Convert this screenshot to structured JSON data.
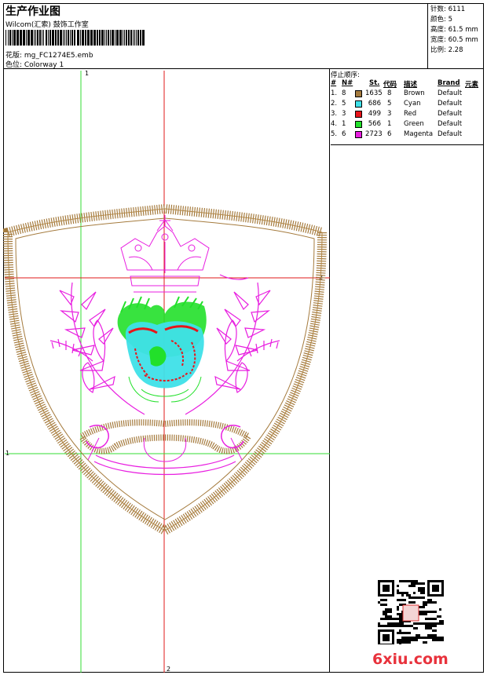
{
  "header": {
    "title": "生产作业图",
    "company": "Wilcom(汇索) 鼓饰工作室",
    "file_label": "花版: mg_FC1274E5.emb",
    "color_label": "色位: Colorway 1"
  },
  "stats": {
    "stitches": "针数: 6111",
    "colors": "颜色: 5",
    "height": "高度: 61.5 mm",
    "width": "宽度: 60.5 mm",
    "scale": "比例: 2.28"
  },
  "guides": {
    "v1": "1",
    "v2": "2",
    "h1": "1",
    "h2": "2"
  },
  "legend": {
    "title": "停止顺序:",
    "headers": [
      "#",
      "N#",
      "St.",
      "代码",
      "描述",
      "Brand",
      "元素"
    ],
    "rows": [
      {
        "idx": "1.",
        "n": "8",
        "st": "1635",
        "code": "8",
        "desc": "Brown",
        "brand": "Default",
        "color": "#a57b3e"
      },
      {
        "idx": "2.",
        "n": "5",
        "st": "686",
        "code": "5",
        "desc": "Cyan",
        "brand": "Default",
        "color": "#3ee0e8"
      },
      {
        "idx": "3.",
        "n": "3",
        "st": "499",
        "code": "3",
        "desc": "Red",
        "brand": "Default",
        "color": "#e8141a"
      },
      {
        "idx": "4.",
        "n": "1",
        "st": "566",
        "code": "1",
        "desc": "Green",
        "brand": "Default",
        "color": "#22e02a"
      },
      {
        "idx": "5.",
        "n": "6",
        "st": "2723",
        "code": "6",
        "desc": "Magenta",
        "brand": "Default",
        "color": "#e81ee0"
      }
    ]
  },
  "watermark": "6xiu.com",
  "colors": {
    "guide_green": "#33dd33",
    "guide_red": "#e01a1a",
    "brown": "#a57b3e",
    "magenta": "#e81ee0",
    "green": "#22e02a",
    "cyan": "#3ee0e8",
    "red": "#e8141a"
  }
}
